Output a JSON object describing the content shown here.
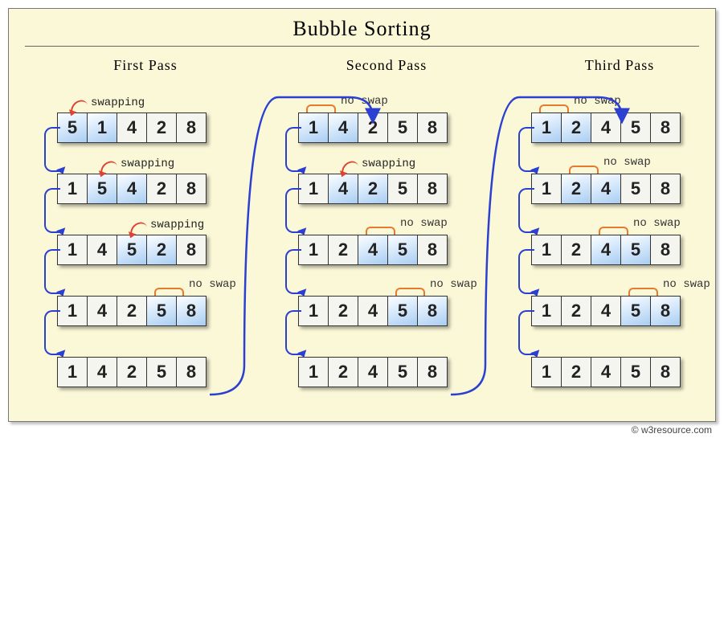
{
  "title": "Bubble  Sorting",
  "credit": "© w3resource.com",
  "labels": {
    "swap": "swapping",
    "noswap": "no swap"
  },
  "passes": [
    {
      "title": "First  Pass",
      "steps": [
        {
          "cells": [
            5,
            1,
            4,
            2,
            8
          ],
          "hl": [
            0,
            1
          ],
          "action": "swap"
        },
        {
          "cells": [
            1,
            5,
            4,
            2,
            8
          ],
          "hl": [
            1,
            2
          ],
          "action": "swap"
        },
        {
          "cells": [
            1,
            4,
            5,
            2,
            8
          ],
          "hl": [
            2,
            3
          ],
          "action": "swap"
        },
        {
          "cells": [
            1,
            4,
            2,
            5,
            8
          ],
          "hl": [
            3,
            4
          ],
          "action": "noswap"
        },
        {
          "cells": [
            1,
            4,
            2,
            5,
            8
          ],
          "hl": [],
          "action": "none"
        }
      ]
    },
    {
      "title": "Second  Pass",
      "steps": [
        {
          "cells": [
            1,
            4,
            2,
            5,
            8
          ],
          "hl": [
            0,
            1
          ],
          "action": "noswap"
        },
        {
          "cells": [
            1,
            4,
            2,
            5,
            8
          ],
          "hl": [
            1,
            2
          ],
          "action": "swap"
        },
        {
          "cells": [
            1,
            2,
            4,
            5,
            8
          ],
          "hl": [
            2,
            3
          ],
          "action": "noswap"
        },
        {
          "cells": [
            1,
            2,
            4,
            5,
            8
          ],
          "hl": [
            3,
            4
          ],
          "action": "noswap"
        },
        {
          "cells": [
            1,
            2,
            4,
            5,
            8
          ],
          "hl": [],
          "action": "none"
        }
      ]
    },
    {
      "title": "Third  Pass",
      "steps": [
        {
          "cells": [
            1,
            2,
            4,
            5,
            8
          ],
          "hl": [
            0,
            1
          ],
          "action": "noswap"
        },
        {
          "cells": [
            1,
            2,
            4,
            5,
            8
          ],
          "hl": [
            1,
            2
          ],
          "action": "noswap"
        },
        {
          "cells": [
            1,
            2,
            4,
            5,
            8
          ],
          "hl": [
            2,
            3
          ],
          "action": "noswap"
        },
        {
          "cells": [
            1,
            2,
            4,
            5,
            8
          ],
          "hl": [
            3,
            4
          ],
          "action": "noswap"
        },
        {
          "cells": [
            1,
            2,
            4,
            5,
            8
          ],
          "hl": [],
          "action": "none"
        }
      ]
    }
  ]
}
